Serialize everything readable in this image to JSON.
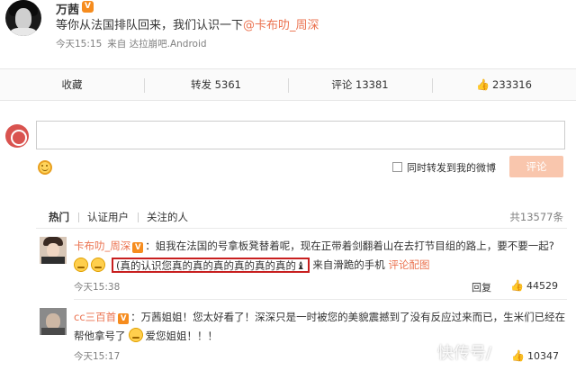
{
  "post": {
    "author": "万茜",
    "verified_badge": "V",
    "text_main": "等你从法国排队回来，我们认识一下",
    "mention": "@卡布叻_周深",
    "time": "今天15:15",
    "source": "来自 达拉崩吧.Android"
  },
  "actions": {
    "favorite": "收藏",
    "repost": "转发 5361",
    "comment": "评论 13381",
    "like": "233316"
  },
  "composer": {
    "input_value": "",
    "repost_label": "同时转发到我的微博",
    "submit_label": "评论"
  },
  "tabs": {
    "hot": "热门",
    "verified": "认证用户",
    "following": "关注的人",
    "total": "共13577条"
  },
  "comments": [
    {
      "author": "卡布叻_周深",
      "badge": "V",
      "text_line1": "：姐我在法国的号拿板凳替着呢，现在正带着剑翻着山在去打节目组的路上，要不要一起?",
      "boxed_text": "(真的认识您真的真的真的真的真的真的",
      "boxed_end": "♝",
      "source": "来自滑跪的手机",
      "source_link": "评论配图",
      "time": "今天15:38",
      "reply": "回复",
      "likes": "44529"
    },
    {
      "author": "cc三百首",
      "badge": "V",
      "text_line1": "：万茜姐姐！您太好看了！深深只是一时被您的美貌震撼到了没有反应过来而已，生米们已经在",
      "text_line2": "帮他拿号了",
      "text_line2_end": "爱您姐姐！！！",
      "time": "今天15:17",
      "likes": "10347"
    }
  ],
  "watermark": "快传号/"
}
